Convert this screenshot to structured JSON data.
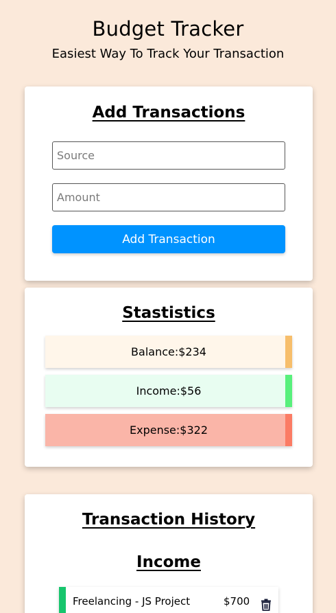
{
  "header": {
    "title": "Budget Tracker",
    "subtitle": "Easiest Way To Track Your Transaction"
  },
  "add_card": {
    "heading": "Add Transactions",
    "source_placeholder": "Source",
    "amount_placeholder": "Amount",
    "submit_label": "Add Transaction"
  },
  "stats_card": {
    "heading": "Stastistics",
    "balance": "Balance:$234",
    "income": "Income:$56",
    "expense": "Expense:$322",
    "colors": {
      "balance_bar": "#f7be6b",
      "income_bar": "#58f07c",
      "expense_bar": "#fb7b64"
    }
  },
  "history_card": {
    "heading": "Transaction History",
    "income_heading": "Income",
    "transactions": [
      {
        "source": "Freelancing - JS Project",
        "amount": "$700",
        "icon": "trash-icon"
      }
    ]
  },
  "colors": {
    "background": "#fbe9da",
    "accent": "#0093ff",
    "income_indicator": "#17c56d"
  }
}
